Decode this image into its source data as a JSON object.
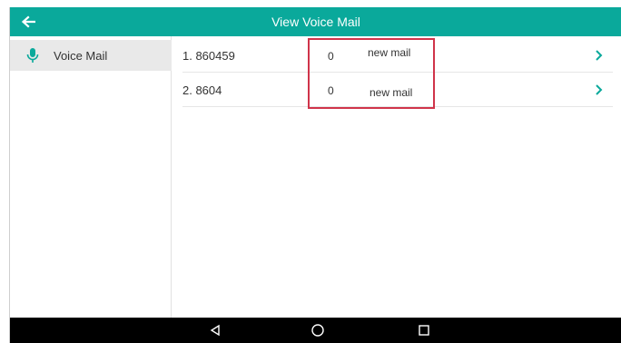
{
  "header": {
    "title": "View Voice Mail"
  },
  "sidebar": {
    "items": [
      {
        "label": "Voice Mail"
      }
    ]
  },
  "voicemail": {
    "rows": [
      {
        "number": "1. 860459",
        "count": "0",
        "label": "new mail"
      },
      {
        "number": "2. 8604",
        "count": "0",
        "label": "new mail"
      }
    ]
  },
  "icons": {
    "back": "back-arrow-icon",
    "mic": "microphone-icon",
    "chevron": "chevron-right-icon",
    "nav_back": "nav-back-triangle-icon",
    "nav_home": "nav-home-circle-icon",
    "nav_recents": "nav-recents-square-icon"
  },
  "colors": {
    "accent": "#0aa99b",
    "highlight_box": "#d0344a",
    "sidebar_selected": "#e9e9e9",
    "navbar": "#000000"
  }
}
